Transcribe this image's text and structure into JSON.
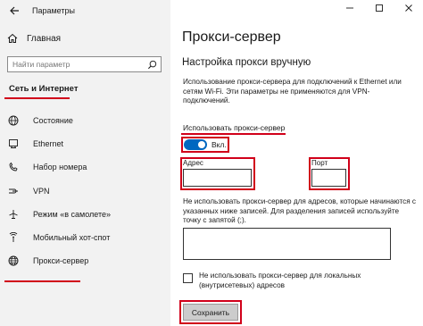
{
  "window": {
    "title": "Параметры",
    "controls": [
      "minimize",
      "maximize",
      "close"
    ]
  },
  "sidebar": {
    "home_label": "Главная",
    "search_placeholder": "Найти параметр",
    "section_title": "Сеть и Интернет",
    "items": [
      {
        "label": "Состояние",
        "icon": "globe-status-icon"
      },
      {
        "label": "Ethernet",
        "icon": "ethernet-icon"
      },
      {
        "label": "Набор номера",
        "icon": "dialup-icon"
      },
      {
        "label": "VPN",
        "icon": "vpn-icon"
      },
      {
        "label": "Режим «в самолете»",
        "icon": "airplane-icon"
      },
      {
        "label": "Мобильный хот-спот",
        "icon": "hotspot-icon"
      },
      {
        "label": "Прокси-сервер",
        "icon": "globe-icon",
        "active": true
      }
    ]
  },
  "main": {
    "page_title": "Прокси-сервер",
    "section_title": "Настройка прокси вручную",
    "description": "Использование прокси-сервера для подключений к Ethernet или сетям Wi-Fi. Эти параметры не применяются для VPN-подключений.",
    "use_proxy_label": "Использовать прокси-сервер",
    "toggle_state_label": "Вкл.",
    "toggle_on": true,
    "address_label": "Адрес",
    "address_value": "",
    "port_label": "Порт",
    "port_value": "",
    "exceptions_description": "Не использовать прокси-сервер для адресов, которые начинаются с указанных ниже записей. Для разделения записей используйте точку с запятой (;).",
    "exceptions_value": "",
    "local_checkbox_label": "Не использовать прокси-сервер для локальных (внутрисетевых) адресов",
    "local_checked": false,
    "save_label": "Сохранить"
  },
  "colors": {
    "sidebar_bg": "#f2f2f2",
    "accent": "#0067c0",
    "highlight_red": "#d1001a",
    "button_bg": "#cccccc"
  }
}
